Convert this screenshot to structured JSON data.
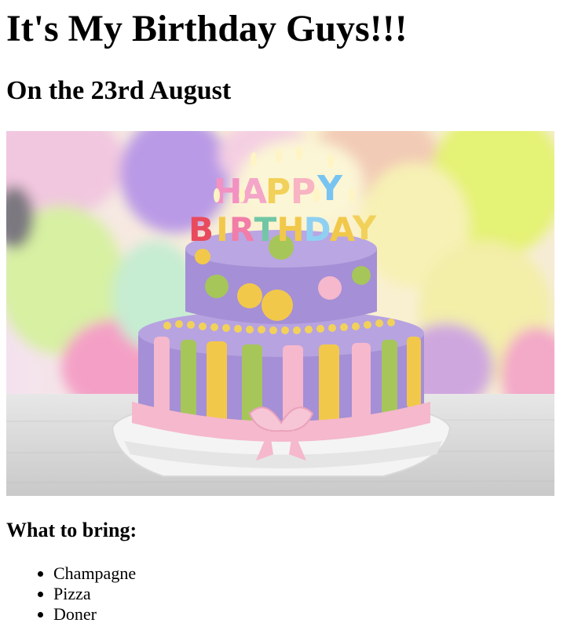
{
  "page": {
    "title": "It's My Birthday Guys!!!",
    "subtitle": "On the 23rd August",
    "image": {
      "subject": "birthday-cake-photo",
      "candle_text_top": "HAPPY",
      "candle_text_bottom": "BIRTHDAY"
    },
    "bring_heading": "What to bring:",
    "bring_items": [
      "Champagne",
      "Pizza",
      "Doner"
    ]
  },
  "colors": {
    "text": "#000000",
    "background": "#ffffff",
    "cake_purple": "#a58fd6",
    "cake_pink": "#f5b8cc",
    "cake_yellow": "#f2c84b",
    "cake_green": "#a6c65a"
  }
}
